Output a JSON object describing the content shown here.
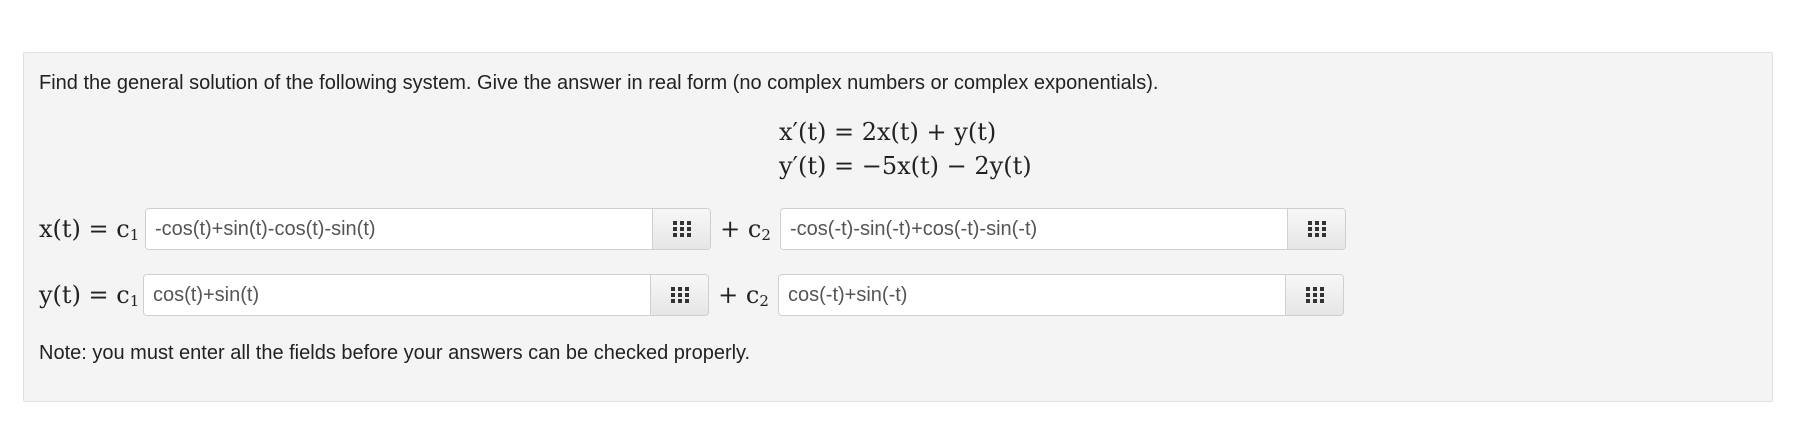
{
  "problem": {
    "instructions": "Find the general solution of the following system. Give the answer in real form (no complex numbers or complex exponentials).",
    "system": {
      "eq1": "x′(t) = 2x(t) + y(t)",
      "eq2": "y′(t) = −5x(t) − 2y(t)"
    },
    "rows": [
      {
        "lhs": "x(t) = c",
        "lhs_sub": "1",
        "plus": "+ c",
        "plus_sub": "2",
        "field1_value": "-cos(t)+sin(t)-cos(t)-sin(t)",
        "field2_value": "-cos(-t)-sin(-t)+cos(-t)-sin(-t)"
      },
      {
        "lhs": "y(t) = c",
        "lhs_sub": "1",
        "plus": "+ c",
        "plus_sub": "2",
        "field1_value": "cos(t)+sin(t)",
        "field2_value": "cos(-t)+sin(-t)"
      }
    ],
    "note": "Note: you must enter all the fields before your answers can be checked properly.",
    "palette_icon": "grid-icon"
  }
}
